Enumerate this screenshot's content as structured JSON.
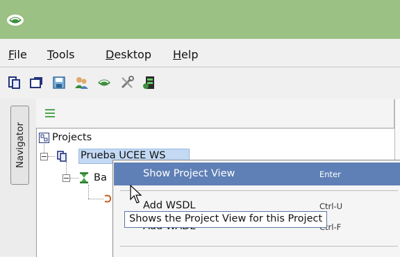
{
  "menu": {
    "file": "File",
    "tools": "Tools",
    "desktop": "Desktop",
    "help": "Help"
  },
  "navigator": {
    "tab_label": "Navigator"
  },
  "tree": {
    "root": "Projects",
    "project": "Prueba UCEE WS",
    "child": "Ba"
  },
  "context_menu": {
    "items": [
      {
        "label": "Show Project View",
        "accelerator": "Enter"
      },
      {
        "label": "Add WSDL",
        "accelerator": "Ctrl-U"
      },
      {
        "label": "Add WADL",
        "accelerator": "Ctrl-F"
      }
    ]
  },
  "tooltip": {
    "text": "Shows the Project View for this Project"
  },
  "colors": {
    "titlebar": "#9bc184",
    "menu_highlight": "#5f80b6",
    "selection": "#c3d9f4"
  },
  "icons": {
    "app": "soapui-logo-icon",
    "toolbar": [
      "new-project-icon",
      "import-project-icon",
      "save-all-icon",
      "workspace-users-icon",
      "soapui-icon",
      "preferences-icon",
      "monitor-icon"
    ]
  }
}
